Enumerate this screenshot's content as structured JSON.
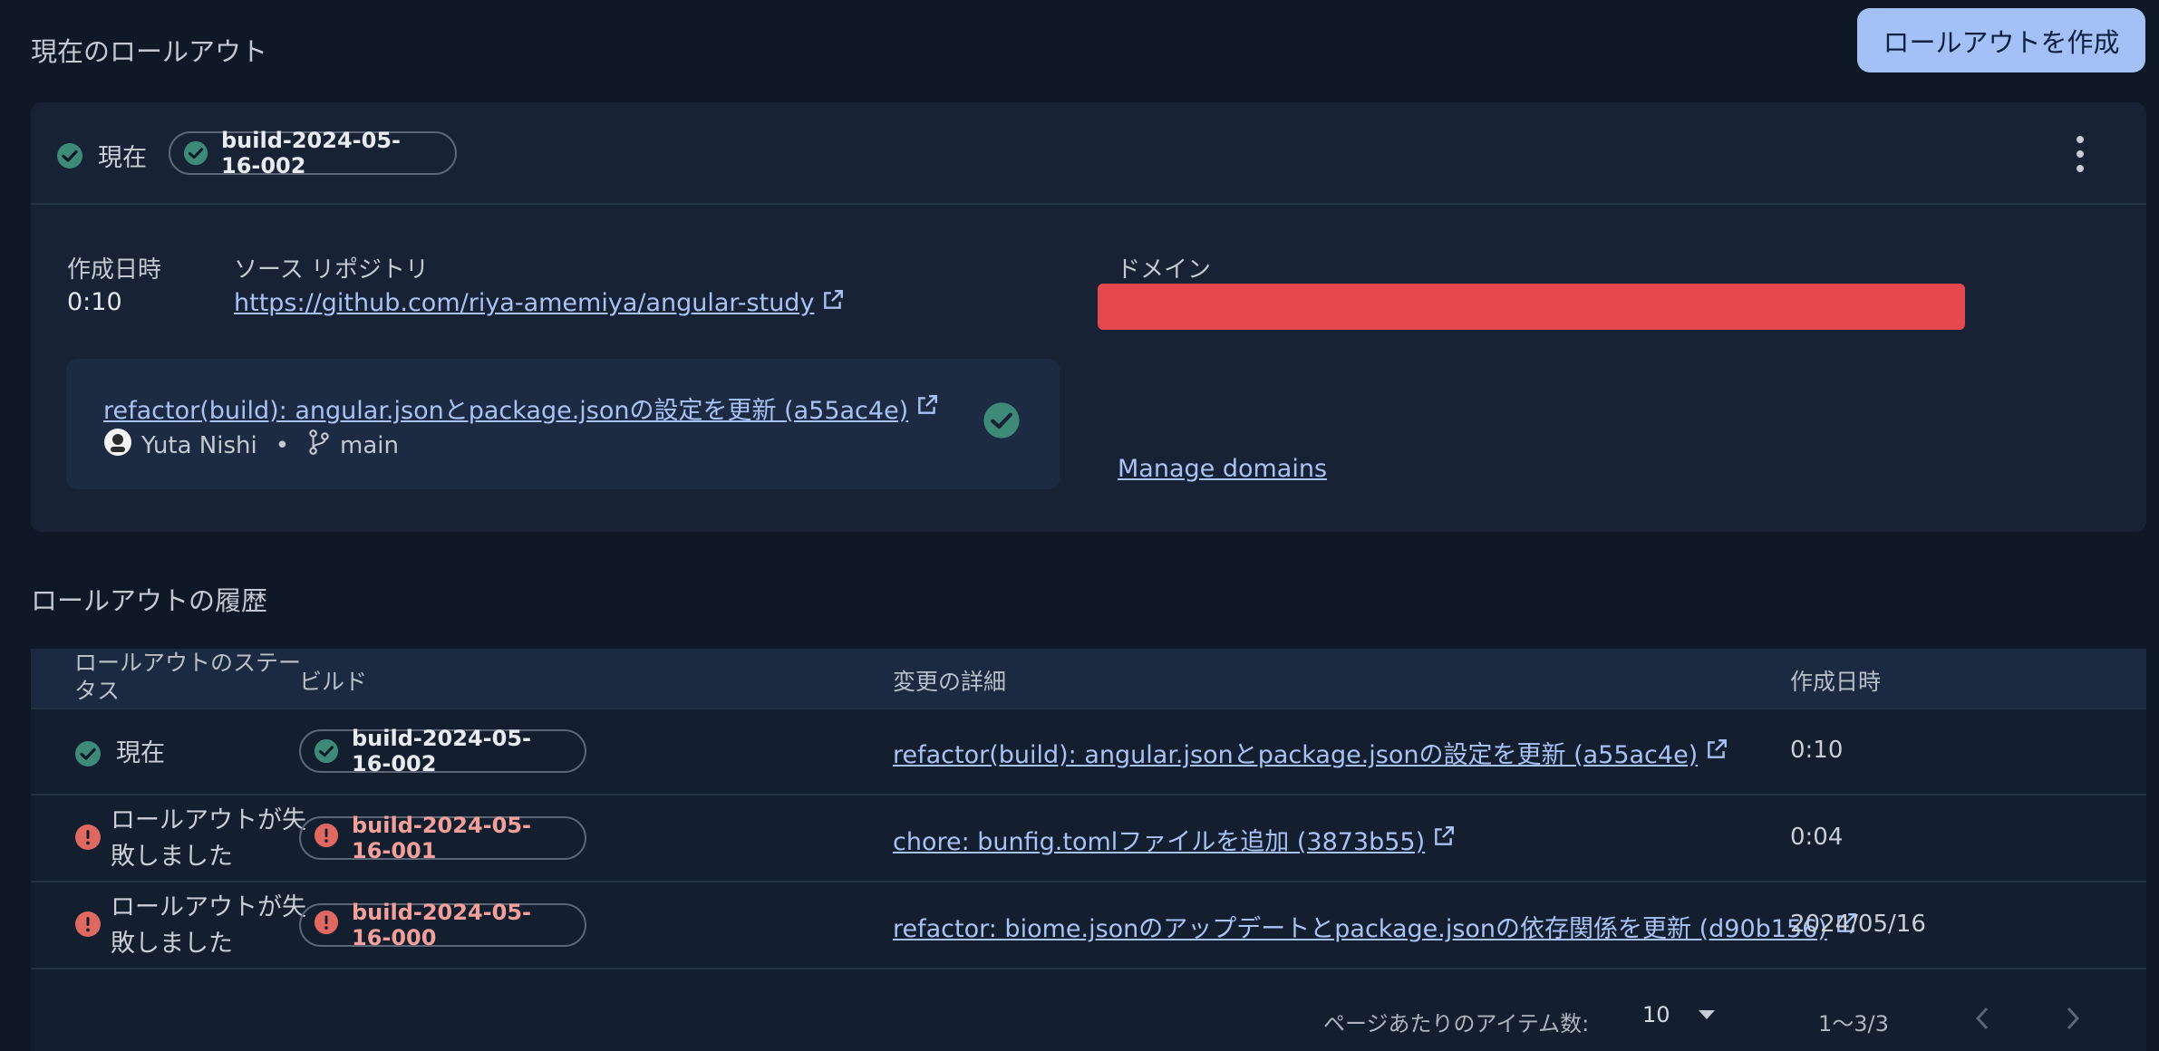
{
  "current_section": {
    "title": "現在のロールアウト",
    "create_button": "ロールアウトを作成",
    "status_label": "現在",
    "build": "build-2024-05-16-002",
    "created_label": "作成日時",
    "created_value": "0:10",
    "repo_label": "ソース リポジトリ",
    "repo_url": "https://github.com/riya-amemiya/angular-study",
    "domain_label": "ドメイン",
    "manage_domains": "Manage domains",
    "commit": {
      "message": "refactor(build): angular.jsonとpackage.jsonの設定を更新 (a55ac4e)",
      "author": "Yuta Nishi",
      "separator": "•",
      "branch": "main"
    }
  },
  "history": {
    "title": "ロールアウトの履歴",
    "columns": [
      "ロールアウトのステータス",
      "ビルド",
      "変更の詳細",
      "作成日時"
    ],
    "rows": [
      {
        "status": "現在",
        "status_kind": "success",
        "build": "build-2024-05-16-002",
        "details": "refactor(build): angular.jsonとpackage.jsonの設定を更新 (a55ac4e)",
        "created": "0:10"
      },
      {
        "status": "ロールアウトが失敗しました",
        "status_kind": "failed",
        "build": "build-2024-05-16-001",
        "details": "chore: bunfig.tomlファイルを追加 (3873b55)",
        "created": "0:04"
      },
      {
        "status": "ロールアウトが失敗しました",
        "status_kind": "failed",
        "build": "build-2024-05-16-000",
        "details": "refactor: biome.jsonのアップデートとpackage.jsonの依存関係を更新 (d90b156)",
        "created": "2024/05/16"
      }
    ],
    "pagination": {
      "per_page_label": "ページあたりのアイテム数:",
      "per_page_value": "10",
      "range": "1〜3/3"
    }
  },
  "colors": {
    "success": "#3d8a78",
    "failed": "#e06862",
    "accent": "#a3c1f7"
  }
}
